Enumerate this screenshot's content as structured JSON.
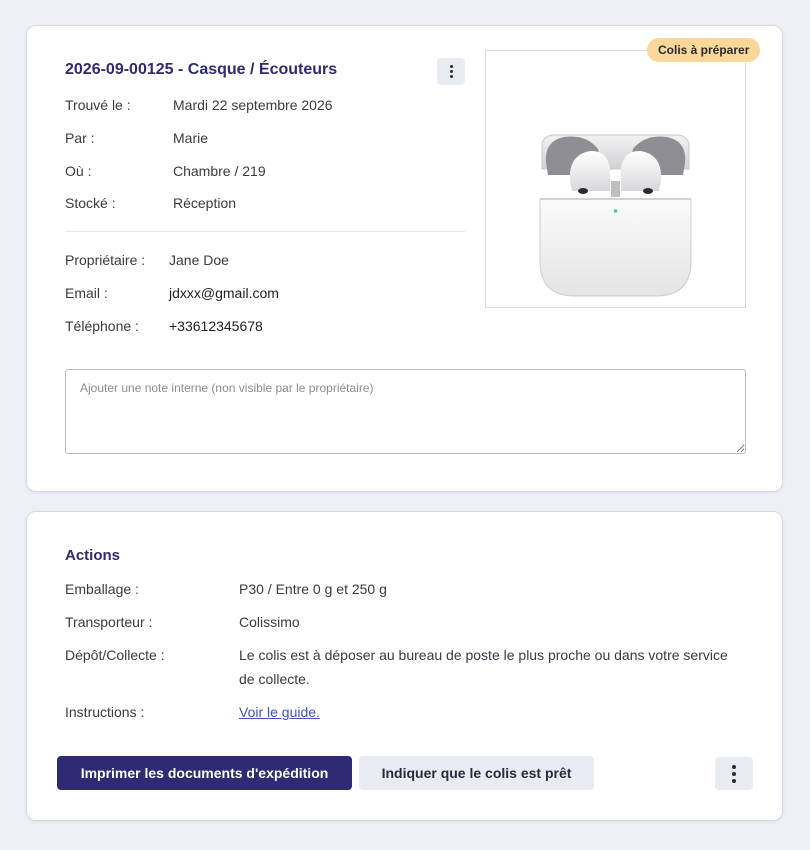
{
  "item": {
    "title": "2026-09-00125 - Casque / Écouteurs",
    "status_badge": "Colis à préparer",
    "found": {
      "label": "Trouvé le :",
      "value": "Mardi 22 septembre 2026"
    },
    "by": {
      "label": "Par :",
      "value": "Marie"
    },
    "where": {
      "label": "Où :",
      "value": "Chambre / 219"
    },
    "stored": {
      "label": "Stocké :",
      "value": "Réception"
    },
    "owner": {
      "label": "Propriétaire :",
      "value": "Jane Doe"
    },
    "email": {
      "label": "Email :",
      "value": "jdxxx@gmail.com"
    },
    "phone": {
      "label": "Téléphone :",
      "value": "+33612345678"
    },
    "note": {
      "placeholder": "Ajouter une note interne (non visible par le propriétaire)",
      "value": ""
    },
    "photo_icon": "earbuds-case-photo"
  },
  "actions": {
    "title": "Actions",
    "packaging": {
      "label": "Emballage :",
      "value": "P30 / Entre 0 g et 250 g"
    },
    "carrier": {
      "label": "Transporteur  :",
      "value": "Colissimo"
    },
    "dropoff": {
      "label": "Dépôt/Collecte :",
      "value": "Le colis est à déposer au bureau de poste le plus proche ou dans votre service de collecte."
    },
    "instructions": {
      "label": "Instructions :",
      "value": "Voir le guide."
    },
    "print_button": "Imprimer les documents d'expédition",
    "ready_button": "Indiquer que le colis est prêt",
    "more_icon": "kebab-menu-icon"
  },
  "colors": {
    "brand": "#2e2a74",
    "badge": "#fbd89a",
    "link": "#4150c9",
    "background": "#eef0f5"
  }
}
